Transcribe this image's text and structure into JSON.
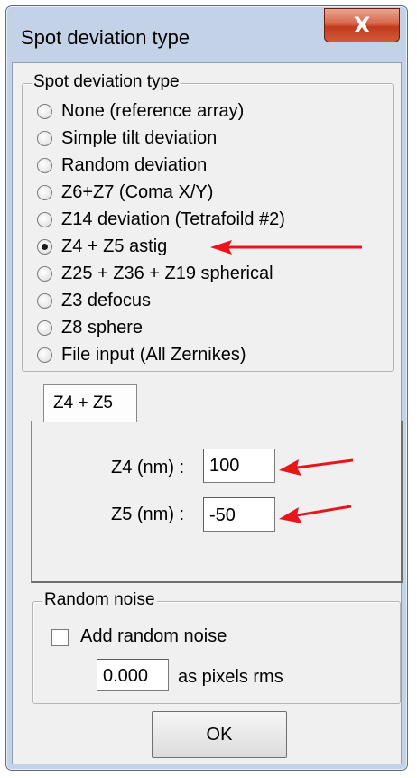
{
  "window": {
    "title": "Spot deviation type",
    "close_glyph": "X"
  },
  "deviation_group": {
    "legend": "Spot deviation type",
    "options": [
      {
        "label": "None (reference array)",
        "selected": false
      },
      {
        "label": "Simple tilt deviation",
        "selected": false
      },
      {
        "label": "Random deviation",
        "selected": false
      },
      {
        "label": "Z6+Z7 (Coma X/Y)",
        "selected": false
      },
      {
        "label": "Z14 deviation (Tetrafoild #2)",
        "selected": false
      },
      {
        "label": "Z4 + Z5 astig",
        "selected": true
      },
      {
        "label": "Z25 + Z36 + Z19 spherical",
        "selected": false
      },
      {
        "label": "Z3 defocus",
        "selected": false
      },
      {
        "label": "Z8 sphere",
        "selected": false
      },
      {
        "label": "File input (All Zernikes)",
        "selected": false
      }
    ]
  },
  "tab": {
    "label": "Z4 + Z5",
    "z4_label": "Z4 (nm) :",
    "z4_value": "100",
    "z5_label": "Z5 (nm) :",
    "z5_value": "-50"
  },
  "noise_group": {
    "legend": "Random noise",
    "checkbox_label": "Add random noise",
    "checked": false,
    "pixels_value": "0.000",
    "pixels_unit": "as pixels rms"
  },
  "ok_label": "OK",
  "annotation_color": "#e8161b"
}
